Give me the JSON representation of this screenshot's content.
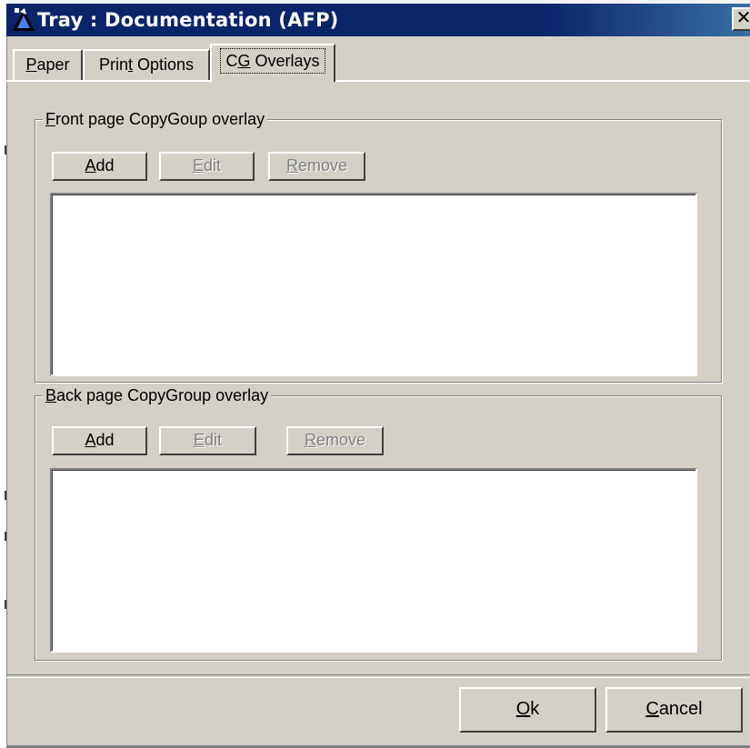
{
  "window": {
    "title": "Tray : Documentation (AFP)",
    "close_label": "✕"
  },
  "tabs": [
    {
      "pre": "",
      "key": "P",
      "post": "aper"
    },
    {
      "pre": "Prin",
      "key": "t",
      "post": " Options"
    },
    {
      "pre": "C",
      "key": "G",
      "post": " Overlays",
      "active": true
    }
  ],
  "front_group": {
    "label_key": "F",
    "label_rest": "ront page CopyGoup overlay",
    "add": {
      "key": "A",
      "rest": "dd"
    },
    "edit": {
      "key": "E",
      "rest": "dit"
    },
    "remove": {
      "key": "R",
      "rest": "emove"
    }
  },
  "back_group": {
    "label_key": "B",
    "label_rest": "ack page CopyGroup overlay",
    "add": {
      "key": "A",
      "rest": "dd"
    },
    "edit": {
      "key": "E",
      "rest": "dit"
    },
    "remove": {
      "key": "R",
      "rest": "emove"
    }
  },
  "footer": {
    "ok": {
      "key": "O",
      "rest": "k"
    },
    "cancel": {
      "key": "C",
      "rest": "ancel"
    }
  },
  "colors": {
    "title_bar": "#0a246a",
    "face": "#d4d0c8",
    "disabled_text": "#808080"
  }
}
